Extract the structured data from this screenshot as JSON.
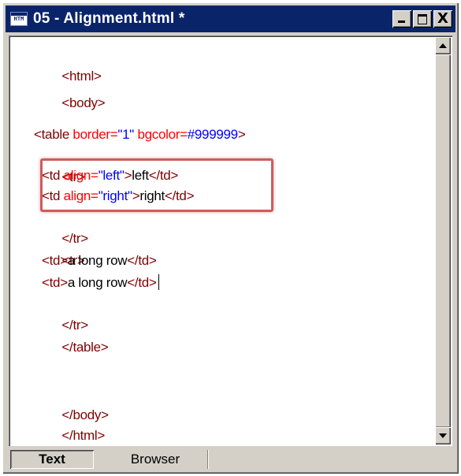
{
  "window": {
    "title": "05 - Alignment.html *",
    "icon_name": "html-file-icon",
    "icon_label": "HTM",
    "controls": {
      "minimize": "_",
      "maximize": "□",
      "close": "X"
    }
  },
  "editor": {
    "colors": {
      "tag": "#800000",
      "attribute": "#ff0000",
      "value": "#0000ff",
      "text": "#000000"
    },
    "lines": {
      "l1": {
        "t1": "<html>"
      },
      "l2": {
        "t1": "<body>"
      },
      "l4": {
        "t1": "<table ",
        "a1": "border=",
        "v1": "\"1\" ",
        "a2": "bgcolor=",
        "v2": "#999999",
        "t2": ">"
      },
      "l5": {
        "t1": "<tr>"
      },
      "l6": {
        "t1": "<td ",
        "a1": "align=",
        "v1": "\"left\"",
        "t2": ">",
        "x1": "left",
        "t3": "</td>"
      },
      "l7": {
        "t1": "<td ",
        "a1": "align=",
        "v1": "\"right\"",
        "t2": ">",
        "x1": "right",
        "t3": "</td>"
      },
      "l8": {
        "t1": "</tr>"
      },
      "l9": {
        "t1": "<tr>"
      },
      "l10": {
        "t1": "<td>",
        "x1": "a long row",
        "t2": "</td>"
      },
      "l11": {
        "t1": "<td>",
        "x1": "a long row",
        "t2": "</td>"
      },
      "l12": {
        "t1": "</tr>"
      },
      "l13": {
        "t1": "</table>"
      },
      "l17": {
        "t1": "</body>"
      },
      "l18": {
        "t1": "</html>"
      }
    },
    "highlight_color": "#cd5c5c"
  },
  "tabs": {
    "text_label": "Text",
    "browser_label": "Browser",
    "active": "Text"
  }
}
